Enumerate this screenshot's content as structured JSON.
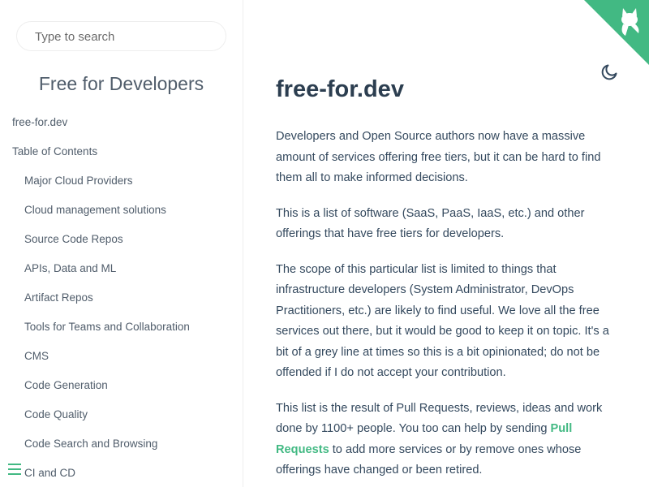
{
  "search": {
    "placeholder": "Type to search"
  },
  "sidebar": {
    "app_name": "Free for Developers",
    "items": [
      {
        "label": "free-for.dev",
        "level": 1
      },
      {
        "label": "Table of Contents",
        "level": 1
      },
      {
        "label": "Major Cloud Providers",
        "level": 2
      },
      {
        "label": "Cloud management solutions",
        "level": 2
      },
      {
        "label": "Source Code Repos",
        "level": 2
      },
      {
        "label": "APIs, Data and ML",
        "level": 2
      },
      {
        "label": "Artifact Repos",
        "level": 2
      },
      {
        "label": "Tools for Teams and Collaboration",
        "level": 2
      },
      {
        "label": "CMS",
        "level": 2
      },
      {
        "label": "Code Generation",
        "level": 2
      },
      {
        "label": "Code Quality",
        "level": 2
      },
      {
        "label": "Code Search and Browsing",
        "level": 2
      },
      {
        "label": "CI and CD",
        "level": 2
      }
    ]
  },
  "icons": {
    "corner": "github-octocat-icon",
    "theme": "moon-icon",
    "menu": "hamburger-menu-icon"
  },
  "colors": {
    "accent": "#42b983",
    "heading": "#2c3e50",
    "text": "#34495e"
  },
  "content": {
    "title": "free-for.dev",
    "p1": "Developers and Open Source authors now have a massive amount of services offering free tiers, but it can be hard to find them all to make informed decisions.",
    "p2": "This is a list of software (SaaS, PaaS, IaaS, etc.) and other offerings that have free tiers for developers.",
    "p3": "The scope of this particular list is limited to things that infrastructure developers (System Administrator, DevOps Practitioners, etc.) are likely to find useful. We love all the free services out there, but it would be good to keep it on topic. It's a bit of a grey line at times so this is a bit opinionated; do not be offended if I do not accept your contribution.",
    "p4_before": "This list is the result of Pull Requests, reviews, ideas and work done by 1100+ people. You too can help by sending ",
    "p4_link": "Pull Requests",
    "p4_after": " to add more services or by remove ones whose offerings have changed or been retired."
  }
}
